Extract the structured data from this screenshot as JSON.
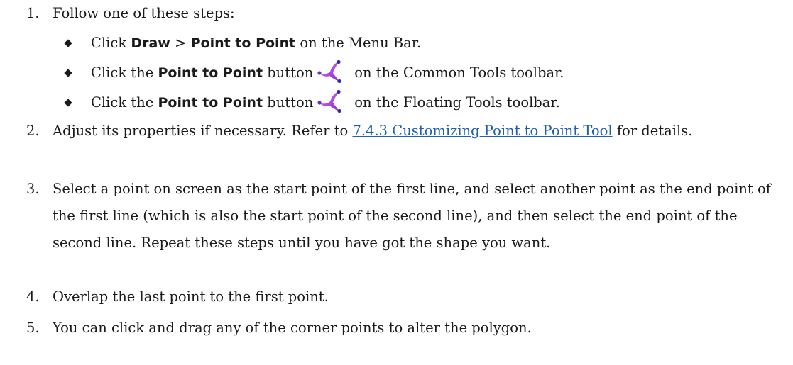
{
  "steps": [
    {
      "number": "1.",
      "text": "Follow one of these steps:"
    },
    {
      "number": "2.",
      "text_before": "Adjust its properties if necessary. Refer to ",
      "link": "7.4.3 Customizing Point to Point Tool",
      "text_after": " for details."
    },
    {
      "number": "3.",
      "text": "Select a point on screen as the start point of the first line, and select another point as the end point of the first line (which is also the start point of the second line), and then select the end point of the second line. Repeat these steps until you have got the shape you want."
    },
    {
      "number": "4.",
      "text": "Overlap the last point to the first point."
    },
    {
      "number": "5.",
      "text": "You can click and drag any of the corner points to alter the polygon."
    }
  ],
  "substeps": [
    {
      "prefix": "Click ",
      "bold1": "Draw",
      "mid": " > ",
      "bold2": "Point to Point",
      "suffix": " on the Menu Bar."
    },
    {
      "prefix": "Click the ",
      "bold": "Point to Point",
      "mid": " button",
      "suffix": "on the Common Tools toolbar.",
      "icon": "point-to-point-icon"
    },
    {
      "prefix": "Click the ",
      "bold": "Point to Point",
      "mid": " button",
      "suffix": "on the Floating Tools toolbar.",
      "icon": "point-to-point-icon"
    }
  ],
  "colors": {
    "text": "#1a1a1a",
    "link": "#1f5fae",
    "icon_primary": "#c23bd6",
    "icon_secondary": "#2a2ab8"
  }
}
